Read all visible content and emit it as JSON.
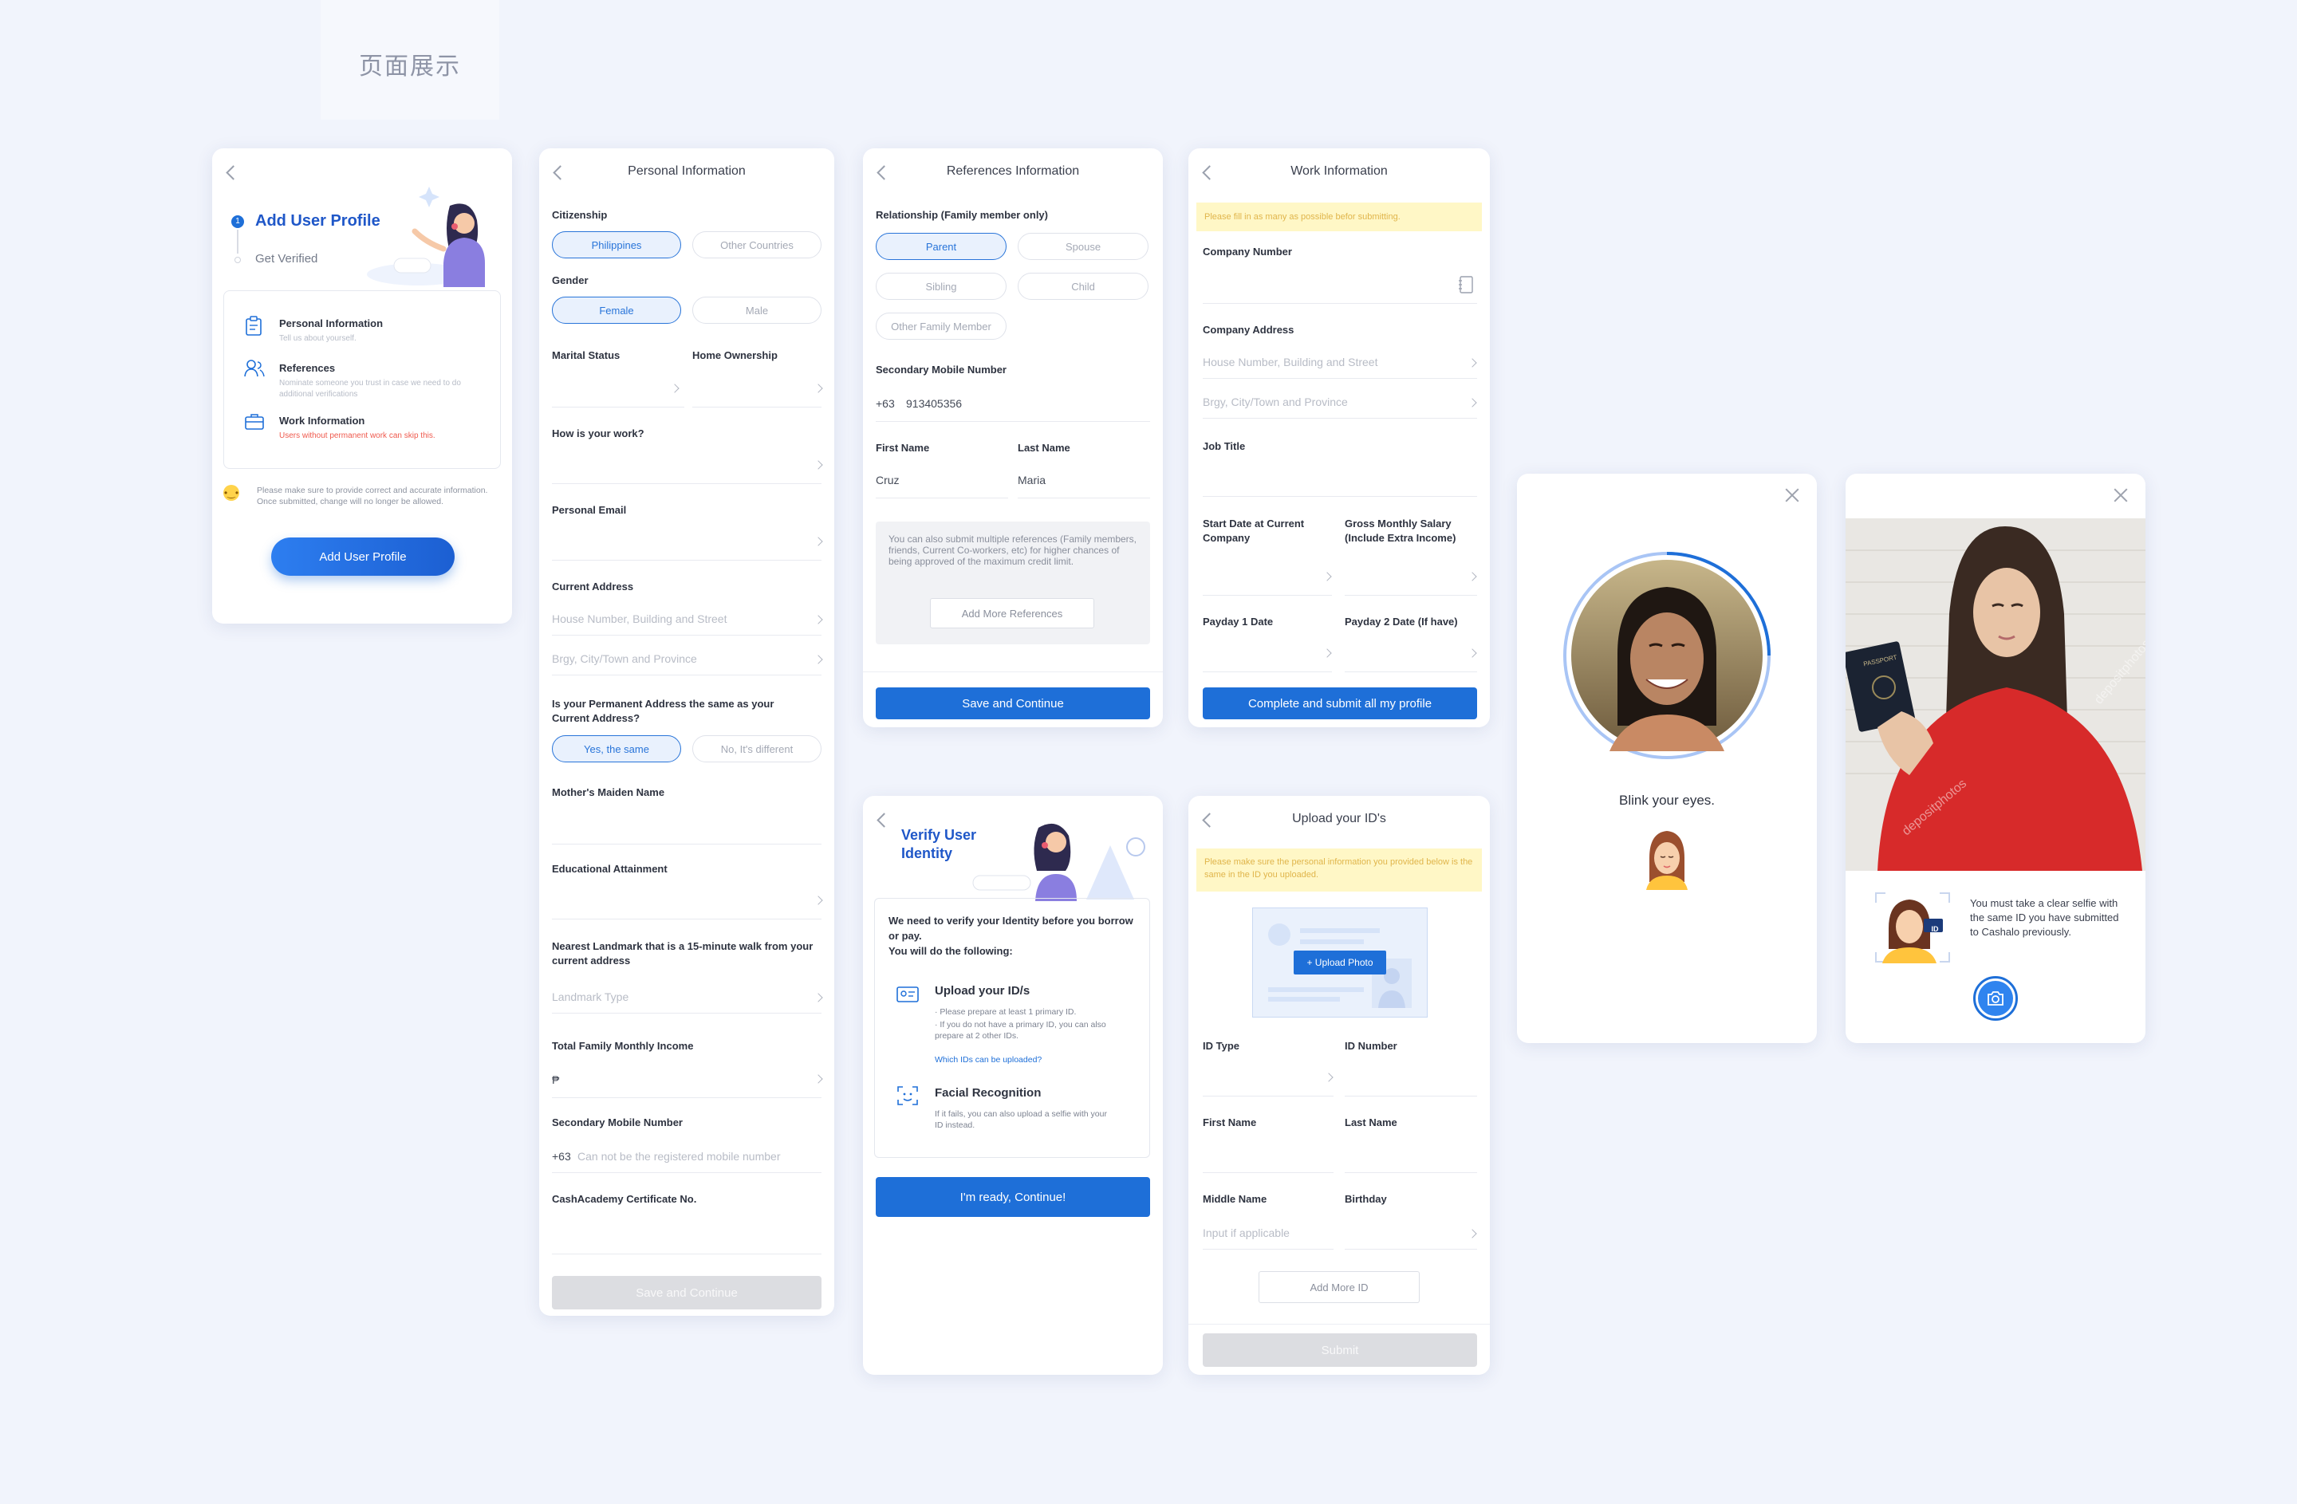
{
  "page_label": "页面展示",
  "add_profile": {
    "title": "Add User Profile",
    "step_num": "1",
    "subtitle": "Get Verified",
    "items": [
      {
        "title": "Personal Information",
        "desc": "Tell us about yourself."
      },
      {
        "title": "References",
        "desc": "Nominate someone you trust in case we need to do additional verifications"
      },
      {
        "title": "Work Information",
        "desc": "Users without permanent work can skip this."
      }
    ],
    "note": "Please make sure to provide correct and accurate information. Once submitted, change will no longer be allowed.",
    "button": "Add User Profile"
  },
  "personal": {
    "title": "Personal Information",
    "citizenship_label": "Citizenship",
    "citizenship_options": [
      "Philippines",
      "Other Countries"
    ],
    "gender_label": "Gender",
    "gender_options": [
      "Female",
      "Male"
    ],
    "marital_label": "Marital Status",
    "home_label": "Home Ownership",
    "work_label": "How is your work?",
    "email_label": "Personal Email",
    "address_label": "Current Address",
    "address_ph1": "House Number, Building and Street",
    "address_ph2": "Brgy, City/Town and Province",
    "perm_label": "Is your Permanent Address the same as your Current Address?",
    "perm_options": [
      "Yes, the same",
      "No, It's different"
    ],
    "maiden_label": "Mother's Maiden Name",
    "edu_label": "Educational Attainment",
    "landmark_label": "Nearest Landmark that is a 15-minute walk from your current address",
    "landmark_ph": "Landmark Type",
    "income_label": "Total Family Monthly Income",
    "income_prefix": "₱",
    "mobile_label": "Secondary Mobile Number",
    "mobile_prefix": "+63",
    "mobile_ph": "Can not be the registered mobile number",
    "cert_label": "CashAcademy Certificate No.",
    "button": "Save and Continue"
  },
  "references": {
    "title": "References Information",
    "rel_label": "Relationship (Family member only)",
    "rel_options": [
      "Parent",
      "Spouse",
      "Sibling",
      "Child",
      "Other Family Member"
    ],
    "mobile_label": "Secondary Mobile Number",
    "mobile_prefix": "+63",
    "mobile_value": "913405356",
    "first_label": "First Name",
    "last_label": "Last Name",
    "first_value": "Cruz",
    "last_value": "Maria",
    "info": "You can also submit multiple references (Family members, friends, Current Co-workers, etc) for higher chances of being approved of the maximum credit limit.",
    "add_btn": "Add More References",
    "button": "Save and Continue"
  },
  "work": {
    "title": "Work Information",
    "notice": "Please fill in as many as possible befor submitting.",
    "company_label": "Company Number",
    "address_label": "Company Address",
    "address_ph1": "House Number, Building and Street",
    "address_ph2": "Brgy, City/Town and Province",
    "job_label": "Job Title",
    "start_label": "Start Date at Current Company",
    "salary_label": "Gross Monthly Salary (Include Extra Income)",
    "pay1_label": "Payday 1 Date",
    "pay2_label": "Payday 2 Date (If have)",
    "button": "Complete and submit all my profile"
  },
  "verify": {
    "title": "Verify User Identity",
    "intro": "We need to verify your Identity before you borrow or pay.",
    "intro2": "You will do the following:",
    "upload_title": "Upload your ID/s",
    "upload_desc1": "· Please prepare at least 1 primary ID.",
    "upload_desc2": "· If you do not have a primary ID, you can also prepare at 2 other IDs.",
    "upload_link": "Which IDs can be uploaded?",
    "face_title": "Facial Recognition",
    "face_desc": "If it fails, you can also upload a selfie with your ID instead.",
    "button": "I'm ready, Continue!"
  },
  "upload": {
    "title": "Upload your ID's",
    "notice": "Please make sure the personal information you provided below is the same in the ID you uploaded.",
    "upload_btn": "+ Upload Photo",
    "idtype_label": "ID Type",
    "idnum_label": "ID Number",
    "first_label": "First Name",
    "last_label": "Last Name",
    "middle_label": "Middle Name",
    "birthday_label": "Birthday",
    "middle_ph": "Input if applicable",
    "add_btn": "Add More ID",
    "button": "Submit"
  },
  "blink": {
    "text": "Blink your eyes."
  },
  "selfie": {
    "text": "You must take a clear selfie with the same ID you have submitted to Cashalo previously.",
    "watermark1": "depositphotos",
    "watermark2": "depositphotos",
    "passport_text": "PASSPORT",
    "id_badge": "ID"
  },
  "colors": {
    "primary": "#1e6fd8",
    "accent_red": "#ef5a4e",
    "notice_bg": "#fff7c6",
    "notice_text": "#e0b54b"
  }
}
